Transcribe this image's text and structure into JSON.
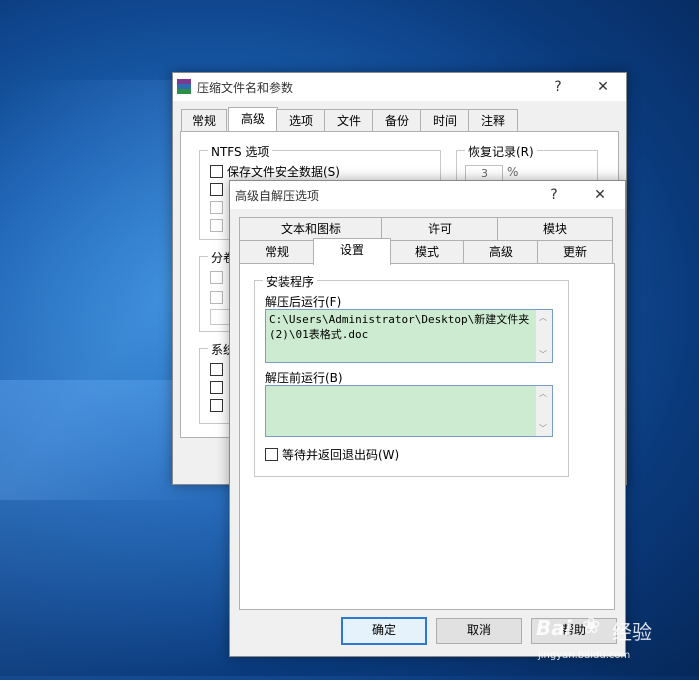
{
  "back_window": {
    "title": "压缩文件名和参数",
    "help": "?",
    "close": "✕",
    "tabs": [
      "常规",
      "高级",
      "选项",
      "文件",
      "备份",
      "时间",
      "注释"
    ],
    "ntfs_group": "NTFS 选项",
    "save_security": "保存文件安全数据(S)",
    "recovery_group": "恢复记录(R)",
    "recovery_value": "3",
    "recovery_unit": "%",
    "split_group": "分卷",
    "system_group": "系统"
  },
  "front_window": {
    "title": "高级自解压选项",
    "help": "?",
    "close": "✕",
    "tabs_row1": [
      "文本和图标",
      "许可",
      "模块"
    ],
    "tabs_row2": [
      "常规",
      "设置",
      "模式",
      "高级",
      "更新"
    ],
    "setup_group": "安装程序",
    "run_after_label": "解压后运行(F)",
    "run_after_value_line1": "C:\\Users\\Administrator\\Desktop\\新建文件夹",
    "run_after_value_line2": "(2)\\01表格式.doc",
    "run_before_label": "解压前运行(B)",
    "run_before_value": "",
    "wait_checkbox_label": "等待并返回退出码(W)",
    "ok": "确定",
    "cancel": "取消",
    "help_button": "帮助"
  },
  "watermark": {
    "brand": "Bai",
    "brand2": "经验",
    "url": "jingyan.baidu.com"
  }
}
